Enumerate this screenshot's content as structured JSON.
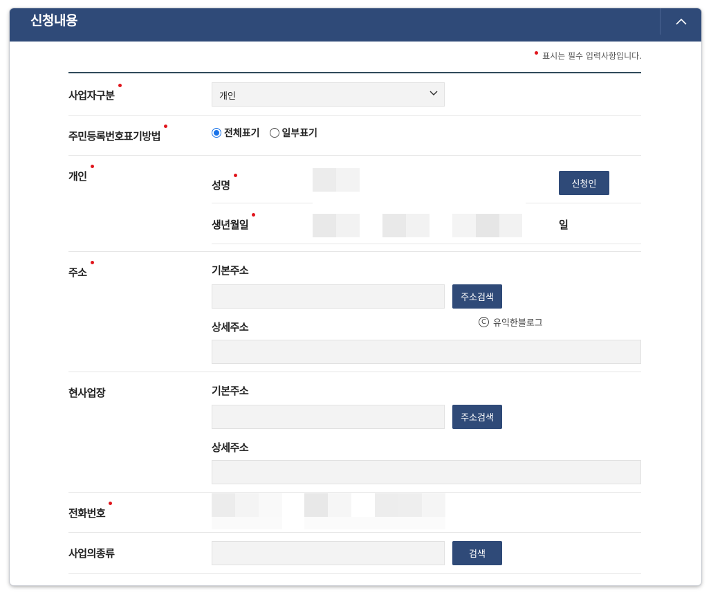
{
  "header": {
    "title": "신청내용"
  },
  "required_note": "표시는 필수 입력사항입니다.",
  "rows": {
    "business_type": {
      "label": "사업자구분",
      "value": "개인"
    },
    "id_display": {
      "label": "주민등록번호표기방법",
      "options": [
        "전체표기",
        "일부표기"
      ],
      "selected": "전체표기"
    },
    "individual": {
      "label": "개인",
      "name_label": "성명",
      "birth_label": "생년월일",
      "day_suffix": "일",
      "applicant_button": "신청인"
    },
    "address": {
      "label": "주소",
      "basic_label": "기본주소",
      "detail_label": "상세주소",
      "search_button": "주소검색"
    },
    "workplace": {
      "label": "현사업장",
      "basic_label": "기본주소",
      "detail_label": "상세주소",
      "search_button": "주소검색"
    },
    "phone": {
      "label": "전화번호"
    },
    "business_kind": {
      "label": "사업의종류",
      "search_button": "검색"
    }
  },
  "watermark": {
    "text": "유익한블로그",
    "symbol": "C"
  },
  "colors": {
    "header_bg": "#2f4a78",
    "button_bg": "#2f4a78",
    "required_dot": "#e0151c",
    "radio_accent": "#1a73e8"
  }
}
